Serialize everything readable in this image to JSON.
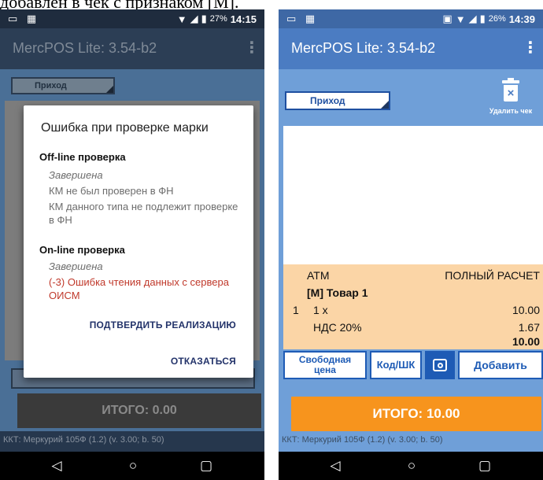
{
  "caption": "добавлен в чек с признаком [М].",
  "left": {
    "status": {
      "sim_icons": "sim-and-image-icons",
      "battery": "27%",
      "time": "14:15"
    },
    "app_title": "MercPOS Lite: 3.54-b2",
    "doc_type": "Приход",
    "total": "ИТОГО: 0.00",
    "kkt": "ККТ: Меркурий 105Ф (1.2) (v. 3.00; b. 50)",
    "dialog": {
      "title": "Ошибка при проверке марки",
      "offline_header": "Off-line проверка",
      "offline_status": "Завершена",
      "offline_line1": "КМ не был проверен в ФН",
      "offline_line2": "КМ данного типа не подлежит проверке в ФН",
      "online_header": "On-line проверка",
      "online_status": "Завершена",
      "online_error": "(-3) Ошибка чтения данных с сервера ОИСМ",
      "confirm_button": "ПОДТВЕРДИТЬ РЕАЛИЗАЦИЮ",
      "decline_button": "ОТКАЗАТЬСЯ"
    }
  },
  "right": {
    "status": {
      "battery": "26%",
      "time": "14:39"
    },
    "app_title": "MercPOS Lite: 3.54-b2",
    "doc_type": "Приход",
    "delete_label": "Удалить чек",
    "receipt": {
      "atm": "ATM",
      "payment_type": "ПОЛНЫЙ РАСЧЕТ",
      "item_name": "[М] Товар 1",
      "item_index": "1",
      "item_qty": "1 х",
      "item_price": "10.00",
      "vat_label": "НДС 20%",
      "vat_amount": "1.67",
      "item_sum": "10.00"
    },
    "buttons": {
      "free_price_line1": "Свободная",
      "free_price_line2": "цена",
      "code": "Код/ШК",
      "add": "Добавить"
    },
    "total": "ИТОГО: 10.00",
    "kkt": "ККТ: Меркурий 105Ф (1.2) (v. 3.00; b. 50)"
  },
  "colors": {
    "appbar_blue": "#4b7cc2",
    "content_blue": "#6f9fd8",
    "receipt_peach": "#fbd5a6",
    "total_orange": "#f7941d",
    "error_red": "#c0392b",
    "button_blue": "#1e5bb5"
  }
}
